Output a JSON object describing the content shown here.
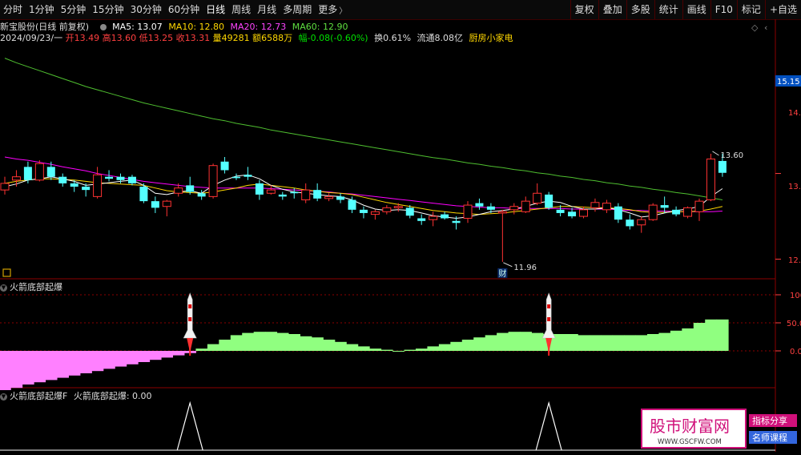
{
  "toolbar": {
    "tabs": [
      "分时",
      "1分钟",
      "5分钟",
      "15分钟",
      "30分钟",
      "60分钟",
      "日线",
      "周线",
      "月线",
      "多周期",
      "更多"
    ],
    "active_tab": "日线",
    "right_buttons": [
      "复权",
      "叠加",
      "多股",
      "统计",
      "画线",
      "F10",
      "标记",
      "+自选"
    ]
  },
  "header": {
    "stock_name": "新宝股份(日线 前复权)",
    "ma5": "MA5: 13.07",
    "ma10": "MA10: 12.80",
    "ma20": "MA20: 12.73",
    "ma60": "MA60: 12.90",
    "date": "2024/09/23/一",
    "open": "开13.49",
    "high": "高13.60",
    "low": "低13.25",
    "close": "收13.31",
    "volume": "量49281",
    "amount": "额6588万",
    "change": "幅-0.08(-0.60%)",
    "turnover": "换0.61%",
    "float_cap": "流通8.08亿",
    "concept": "厨房小家电"
  },
  "colors": {
    "up": "#ff3232",
    "down": "#54ffff",
    "ma5": "#ffffff",
    "ma10": "#ffd700",
    "ma20": "#ff00ff",
    "ma60": "#4fbf30",
    "grid": "#8b0000"
  },
  "price_axis": {
    "labels": [
      "14.7",
      "13.3",
      "12.0"
    ],
    "current": "15.15"
  },
  "annotations": {
    "high_label": "13.60",
    "low_label": "11.96",
    "fin_badge": "财",
    "box_icon": "▣"
  },
  "panel2": {
    "title": "火箭底部起爆",
    "axis_labels": [
      "100",
      "50.0",
      "0.00"
    ]
  },
  "panel3": {
    "title": "火箭底部起爆F",
    "formula": "火箭底部起爆: 0.00"
  },
  "watermark": {
    "title": "股市财富网",
    "url": "WWW.GSCFW.COM",
    "tag1": "指标分享",
    "tag2": "名师课程"
  },
  "chart_data": {
    "type": "candlestick",
    "candles": [
      [
        13.05,
        13.25,
        12.98,
        13.15
      ],
      [
        13.2,
        13.35,
        13.1,
        13.25
      ],
      [
        13.4,
        13.48,
        13.15,
        13.2
      ],
      [
        13.2,
        13.5,
        13.18,
        13.45
      ],
      [
        13.4,
        13.48,
        13.2,
        13.25
      ],
      [
        13.25,
        13.3,
        13.1,
        13.15
      ],
      [
        13.15,
        13.2,
        13.02,
        13.1
      ],
      [
        13.1,
        13.15,
        12.95,
        13.05
      ],
      [
        12.95,
        13.4,
        12.92,
        13.28
      ],
      [
        13.25,
        13.35,
        13.18,
        13.22
      ],
      [
        13.25,
        13.3,
        13.15,
        13.2
      ],
      [
        13.25,
        13.28,
        13.12,
        13.15
      ],
      [
        13.1,
        13.15,
        12.85,
        12.88
      ],
      [
        12.88,
        12.95,
        12.7,
        12.78
      ],
      [
        12.8,
        12.9,
        12.65,
        12.88
      ],
      [
        13.0,
        13.15,
        12.95,
        13.08
      ],
      [
        13.12,
        13.25,
        12.98,
        13.02
      ],
      [
        13.0,
        13.05,
        12.9,
        12.95
      ],
      [
        12.95,
        13.45,
        12.92,
        13.42
      ],
      [
        13.48,
        13.55,
        13.3,
        13.35
      ],
      [
        13.25,
        13.3,
        13.2,
        13.23
      ],
      [
        13.28,
        13.4,
        13.2,
        13.25
      ],
      [
        13.15,
        13.2,
        12.9,
        12.98
      ],
      [
        13.0,
        13.12,
        12.98,
        13.05
      ],
      [
        12.98,
        13.02,
        12.9,
        12.95
      ],
      [
        13.02,
        13.08,
        12.92,
        13.0
      ],
      [
        12.9,
        13.15,
        12.85,
        13.05
      ],
      [
        13.05,
        13.15,
        12.88,
        12.92
      ],
      [
        12.92,
        13.0,
        12.88,
        12.95
      ],
      [
        12.95,
        13.0,
        12.85,
        12.9
      ],
      [
        12.9,
        12.95,
        12.7,
        12.75
      ],
      [
        12.75,
        12.8,
        12.62,
        12.7
      ],
      [
        12.68,
        12.75,
        12.6,
        12.72
      ],
      [
        12.72,
        12.82,
        12.68,
        12.78
      ],
      [
        12.78,
        12.85,
        12.72,
        12.8
      ],
      [
        12.78,
        12.82,
        12.62,
        12.66
      ],
      [
        12.62,
        12.68,
        12.52,
        12.58
      ],
      [
        12.6,
        12.72,
        12.5,
        12.65
      ],
      [
        12.68,
        12.72,
        12.6,
        12.62
      ],
      [
        12.58,
        12.65,
        12.45,
        12.55
      ],
      [
        12.62,
        12.88,
        12.55,
        12.82
      ],
      [
        12.85,
        12.92,
        12.75,
        12.8
      ],
      [
        12.8,
        12.85,
        12.7,
        12.75
      ],
      [
        12.7,
        12.75,
        11.96,
        12.72
      ],
      [
        12.75,
        12.85,
        12.68,
        12.8
      ],
      [
        12.72,
        12.95,
        12.7,
        12.88
      ],
      [
        12.85,
        13.15,
        12.82,
        13.0
      ],
      [
        12.98,
        13.02,
        12.75,
        12.78
      ],
      [
        12.75,
        12.82,
        12.65,
        12.7
      ],
      [
        12.72,
        12.78,
        12.62,
        12.65
      ],
      [
        12.65,
        12.8,
        12.62,
        12.75
      ],
      [
        12.78,
        12.92,
        12.72,
        12.86
      ],
      [
        12.75,
        12.9,
        12.7,
        12.85
      ],
      [
        12.8,
        12.85,
        12.55,
        12.6
      ],
      [
        12.6,
        12.68,
        12.45,
        12.5
      ],
      [
        12.52,
        12.65,
        12.4,
        12.6
      ],
      [
        12.6,
        12.85,
        12.58,
        12.82
      ],
      [
        12.82,
        12.95,
        12.7,
        12.78
      ],
      [
        12.75,
        12.8,
        12.65,
        12.68
      ],
      [
        12.65,
        12.8,
        12.62,
        12.78
      ],
      [
        12.72,
        12.92,
        12.58,
        12.88
      ],
      [
        12.9,
        13.6,
        12.88,
        13.52
      ],
      [
        13.49,
        13.6,
        13.25,
        13.31
      ]
    ],
    "ma5": [
      13.1,
      13.14,
      13.2,
      13.22,
      13.25,
      13.22,
      13.18,
      13.12,
      13.14,
      13.16,
      13.18,
      13.2,
      13.12,
      13.0,
      12.98,
      13.02,
      13.04,
      13.0,
      13.12,
      13.2,
      13.26,
      13.28,
      13.22,
      13.12,
      13.06,
      13.02,
      13.0,
      12.98,
      12.96,
      12.95,
      12.9,
      12.82,
      12.76,
      12.74,
      12.75,
      12.74,
      12.7,
      12.66,
      12.64,
      12.62,
      12.64,
      12.68,
      12.72,
      12.74,
      12.76,
      12.8,
      12.85,
      12.88,
      12.86,
      12.8,
      12.76,
      12.76,
      12.78,
      12.75,
      12.7,
      12.64,
      12.66,
      12.7,
      12.74,
      12.76,
      12.8,
      12.95,
      13.07
    ],
    "ma10": [
      13.15,
      13.18,
      13.2,
      13.22,
      13.22,
      13.21,
      13.2,
      13.18,
      13.16,
      13.15,
      13.14,
      13.13,
      13.12,
      13.08,
      13.04,
      13.02,
      13.01,
      13.0,
      13.02,
      13.05,
      13.08,
      13.12,
      13.14,
      13.12,
      13.1,
      13.08,
      13.05,
      13.03,
      13.01,
      13.0,
      12.98,
      12.94,
      12.9,
      12.86,
      12.83,
      12.8,
      12.77,
      12.74,
      12.72,
      12.7,
      12.69,
      12.68,
      12.69,
      12.7,
      12.72,
      12.74,
      12.76,
      12.78,
      12.8,
      12.8,
      12.79,
      12.78,
      12.78,
      12.77,
      12.75,
      12.72,
      12.71,
      12.71,
      12.72,
      12.72,
      12.73,
      12.76,
      12.8
    ],
    "ma20": [
      13.55,
      13.52,
      13.5,
      13.47,
      13.44,
      13.4,
      13.37,
      13.34,
      13.3,
      13.27,
      13.24,
      13.21,
      13.18,
      13.16,
      13.14,
      13.12,
      13.1,
      13.09,
      13.08,
      13.08,
      13.08,
      13.08,
      13.08,
      13.07,
      13.06,
      13.05,
      13.04,
      13.03,
      13.02,
      13.0,
      12.99,
      12.97,
      12.95,
      12.93,
      12.91,
      12.89,
      12.87,
      12.85,
      12.83,
      12.81,
      12.8,
      12.79,
      12.78,
      12.78,
      12.77,
      12.77,
      12.77,
      12.77,
      12.77,
      12.76,
      12.76,
      12.76,
      12.76,
      12.75,
      12.74,
      12.74,
      12.73,
      12.73,
      12.72,
      12.72,
      12.72,
      12.72,
      12.73
    ],
    "ma60": [
      15.05,
      14.98,
      14.92,
      14.86,
      14.8,
      14.74,
      14.68,
      14.62,
      14.57,
      14.52,
      14.47,
      14.42,
      14.37,
      14.33,
      14.29,
      14.25,
      14.21,
      14.17,
      14.13,
      14.1,
      14.06,
      14.03,
      14.0,
      13.96,
      13.93,
      13.9,
      13.87,
      13.84,
      13.81,
      13.78,
      13.75,
      13.72,
      13.69,
      13.66,
      13.63,
      13.6,
      13.57,
      13.54,
      13.52,
      13.49,
      13.46,
      13.44,
      13.41,
      13.39,
      13.36,
      13.34,
      13.31,
      13.29,
      13.26,
      13.24,
      13.21,
      13.19,
      13.16,
      13.14,
      13.11,
      13.09,
      13.06,
      13.04,
      13.01,
      12.99,
      12.96,
      12.93,
      12.9
    ],
    "rocket_signal": [
      0,
      0,
      0,
      0,
      0,
      0,
      0,
      0,
      0,
      0,
      0,
      0,
      0,
      0,
      0,
      0,
      1,
      0,
      0,
      0,
      0,
      0,
      0,
      0,
      0,
      0,
      0,
      0,
      0,
      0,
      0,
      0,
      0,
      0,
      0,
      0,
      0,
      0,
      0,
      0,
      0,
      0,
      0,
      0,
      0,
      0,
      0,
      1,
      0,
      0,
      0,
      0,
      0,
      0,
      0,
      0,
      0,
      0,
      0,
      0,
      0,
      0,
      0
    ],
    "bottom_hist": [
      -0.35,
      -0.33,
      -0.3,
      -0.28,
      -0.26,
      -0.24,
      -0.22,
      -0.2,
      -0.18,
      -0.16,
      -0.14,
      -0.12,
      -0.1,
      -0.08,
      -0.06,
      -0.04,
      -0.02,
      0.02,
      0.06,
      0.1,
      0.14,
      0.16,
      0.17,
      0.17,
      0.16,
      0.15,
      0.13,
      0.12,
      0.1,
      0.08,
      0.06,
      0.04,
      0.02,
      0.01,
      0.0,
      0.01,
      0.02,
      0.04,
      0.06,
      0.08,
      0.1,
      0.12,
      0.14,
      0.16,
      0.17,
      0.17,
      0.16,
      0.15,
      0.15,
      0.15,
      0.14,
      0.14,
      0.14,
      0.14,
      0.14,
      0.14,
      0.15,
      0.16,
      0.18,
      0.2,
      0.25,
      0.28,
      0.28
    ]
  }
}
